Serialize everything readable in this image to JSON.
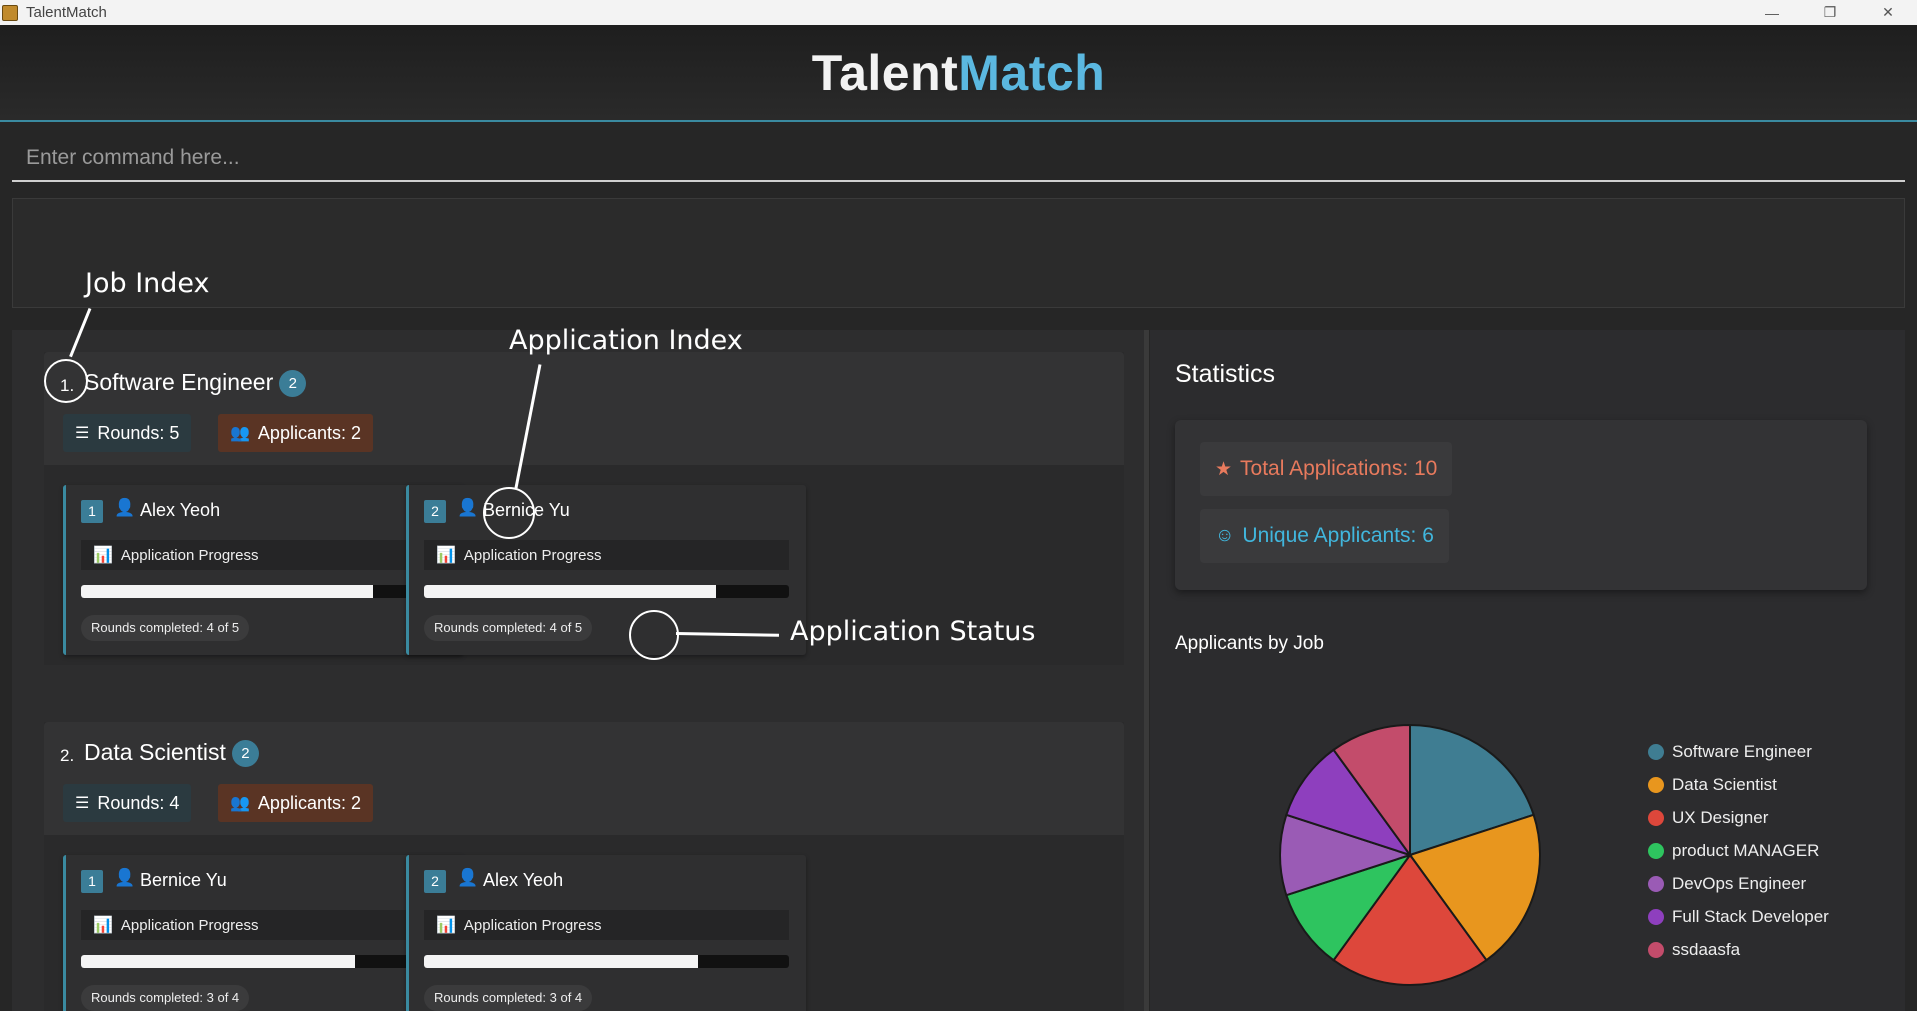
{
  "window": {
    "title": "TalentMatch",
    "minimize": "—",
    "maximize": "❐",
    "close": "✕"
  },
  "brand": {
    "part1": "Talent",
    "part2": "Match"
  },
  "command": {
    "placeholder": "Enter command here..."
  },
  "annotations": {
    "job_index": "Job Index",
    "application_index": "Application Index",
    "application_status": "Application Status"
  },
  "jobs": [
    {
      "index": "1.",
      "title": "Software Engineer",
      "count": "2",
      "rounds": "Rounds: 5",
      "applicants": "Applicants: 2",
      "applications": [
        {
          "index": "1",
          "name": "Alex Yeoh",
          "progress_label": "Application Progress",
          "progress": 0.8,
          "status": "Rounds completed: 4 of 5"
        },
        {
          "index": "2",
          "name": "Bernice Yu",
          "progress_label": "Application Progress",
          "progress": 0.8,
          "status": "Rounds completed: 4 of 5"
        }
      ]
    },
    {
      "index": "2.",
      "title": "Data Scientist",
      "count": "2",
      "rounds": "Rounds: 4",
      "applicants": "Applicants: 2",
      "applications": [
        {
          "index": "1",
          "name": "Bernice Yu",
          "progress_label": "Application Progress",
          "progress": 0.75,
          "status": "Rounds completed: 3 of 4"
        },
        {
          "index": "2",
          "name": "Alex Yeoh",
          "progress_label": "Application Progress",
          "progress": 0.75,
          "status": "Rounds completed: 3 of 4"
        }
      ]
    }
  ],
  "statistics": {
    "title": "Statistics",
    "total": "Total Applications: 10",
    "unique": "Unique Applicants: 6",
    "chart_title": "Applicants by Job"
  },
  "chart_data": {
    "type": "pie",
    "title": "Applicants by Job",
    "categories": [
      "Software Engineer",
      "Data Scientist",
      "UX Designer",
      "product MANAGER",
      "DevOps Engineer",
      "Full Stack Developer",
      "ssdaasfa"
    ],
    "values": [
      2,
      2,
      2,
      1,
      1,
      1,
      1
    ],
    "colors": [
      "#3f7d92",
      "#e8961e",
      "#dd473b",
      "#2ec45f",
      "#9a5bb5",
      "#8e3fbe",
      "#c34c6b"
    ],
    "legend": "right"
  }
}
